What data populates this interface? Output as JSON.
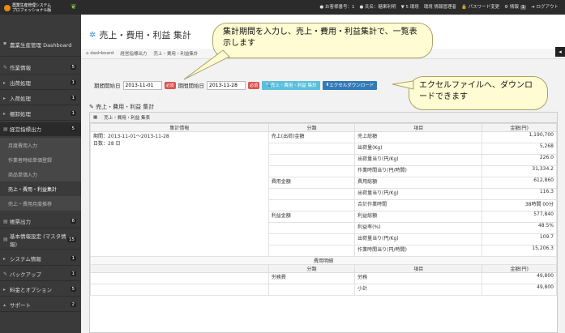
{
  "topbar": {
    "logo_line1": "農業生産管理システム",
    "logo_line2": "プロフェッショナル版",
    "items": [
      {
        "icon": "user-icon",
        "label": "お客様番号：1"
      },
      {
        "icon": "person-icon",
        "label": "氏名：糖果利明"
      },
      {
        "icon": "bell-icon",
        "label": "5 環境"
      },
      {
        "icon": "database-icon",
        "label": "環境 情報管理者"
      },
      {
        "icon": "lock-icon",
        "label": "パスワード変更"
      },
      {
        "icon": "info-icon",
        "label": "情報",
        "badge": "1"
      },
      {
        "icon": "logout-icon",
        "label": "ログアウト"
      }
    ]
  },
  "sidebar": {
    "header": "農業生産管理 Dashboard",
    "items": [
      {
        "label": "作業情報",
        "count": "5"
      },
      {
        "label": "出荷処理",
        "count": "1"
      },
      {
        "label": "入荷処理",
        "count": "1"
      },
      {
        "label": "棚卸処理",
        "count": "1"
      },
      {
        "label": "経営指標出力",
        "count": "5"
      }
    ],
    "subitems": [
      "月度費用入力",
      "作業者時給単価登録",
      "商品単価入力",
      "売上・費用・利益集計",
      "売上・費用月度推移"
    ],
    "items2": [
      {
        "label": "帳票出力",
        "count": "6"
      },
      {
        "label": "基本情報設定 (マスタ情報)",
        "count": "15"
      },
      {
        "label": "システム情報",
        "count": "1"
      },
      {
        "label": "バックアップ",
        "count": "1"
      },
      {
        "label": "料金とオプション",
        "count": "5"
      },
      {
        "label": "サポート",
        "count": "2"
      }
    ]
  },
  "page": {
    "title": "売上・費用・利益 集計",
    "breadcrumb": [
      "dashboard",
      "経営指標出力",
      "売上・費用・利益集計"
    ]
  },
  "filter": {
    "label_start": "期間開始日",
    "start_value": "2013-11-01",
    "label_end": "期間開始日",
    "end_value": "2013-11-28",
    "required": "必須",
    "btn_aggregate": "売上・費用・利益 集計",
    "btn_excel": "エクセルダウンロード"
  },
  "section": {
    "title": "売上・費用・利益 集計",
    "panel_title": "売上・費用・利益 集表",
    "col_info": "集計情報",
    "col_cat": "分類",
    "col_item": "項目",
    "col_amount": "金額(円)",
    "period": "期間：2013-11-01～2013-11-28",
    "days": "日数：28 日",
    "rows": [
      {
        "cat": "売上(出荷)金額",
        "item": "売上総額",
        "amount": "1,190,700"
      },
      {
        "cat": "",
        "item": "出荷量(Kg)",
        "amount": "5,268"
      },
      {
        "cat": "",
        "item": "出荷量当り(円/Kg)",
        "amount": "226.0"
      },
      {
        "cat": "",
        "item": "作業時間当り(円/時間)",
        "amount": "31,334.2"
      },
      {
        "cat": "費用金額",
        "item": "費用総額",
        "amount": "612,860"
      },
      {
        "cat": "",
        "item": "出荷量当り(円/Kg)",
        "amount": "116.3"
      },
      {
        "cat": "",
        "item": "合計作業時間",
        "amount": "38時間 00分"
      },
      {
        "cat": "利益金額",
        "item": "利益総額",
        "amount": "577,840"
      },
      {
        "cat": "",
        "item": "利益率(%)",
        "amount": "48.5%"
      },
      {
        "cat": "",
        "item": "出荷量当り(円/Kg)",
        "amount": "109.7"
      },
      {
        "cat": "",
        "item": "作業時間当り(円/時間)",
        "amount": "15,206.3"
      }
    ],
    "expense_title": "費用明細",
    "expense_rows": [
      {
        "cat": "労務費",
        "item": "労務",
        "amount": "49,800"
      },
      {
        "cat": "",
        "item": "小計",
        "amount": "49,800"
      }
    ]
  },
  "callouts": {
    "c1": "集計期間を入力し、売上・費用・利益集計で、一覧表示します",
    "c2": "エクセルファイルへ、ダウンロードできます"
  }
}
